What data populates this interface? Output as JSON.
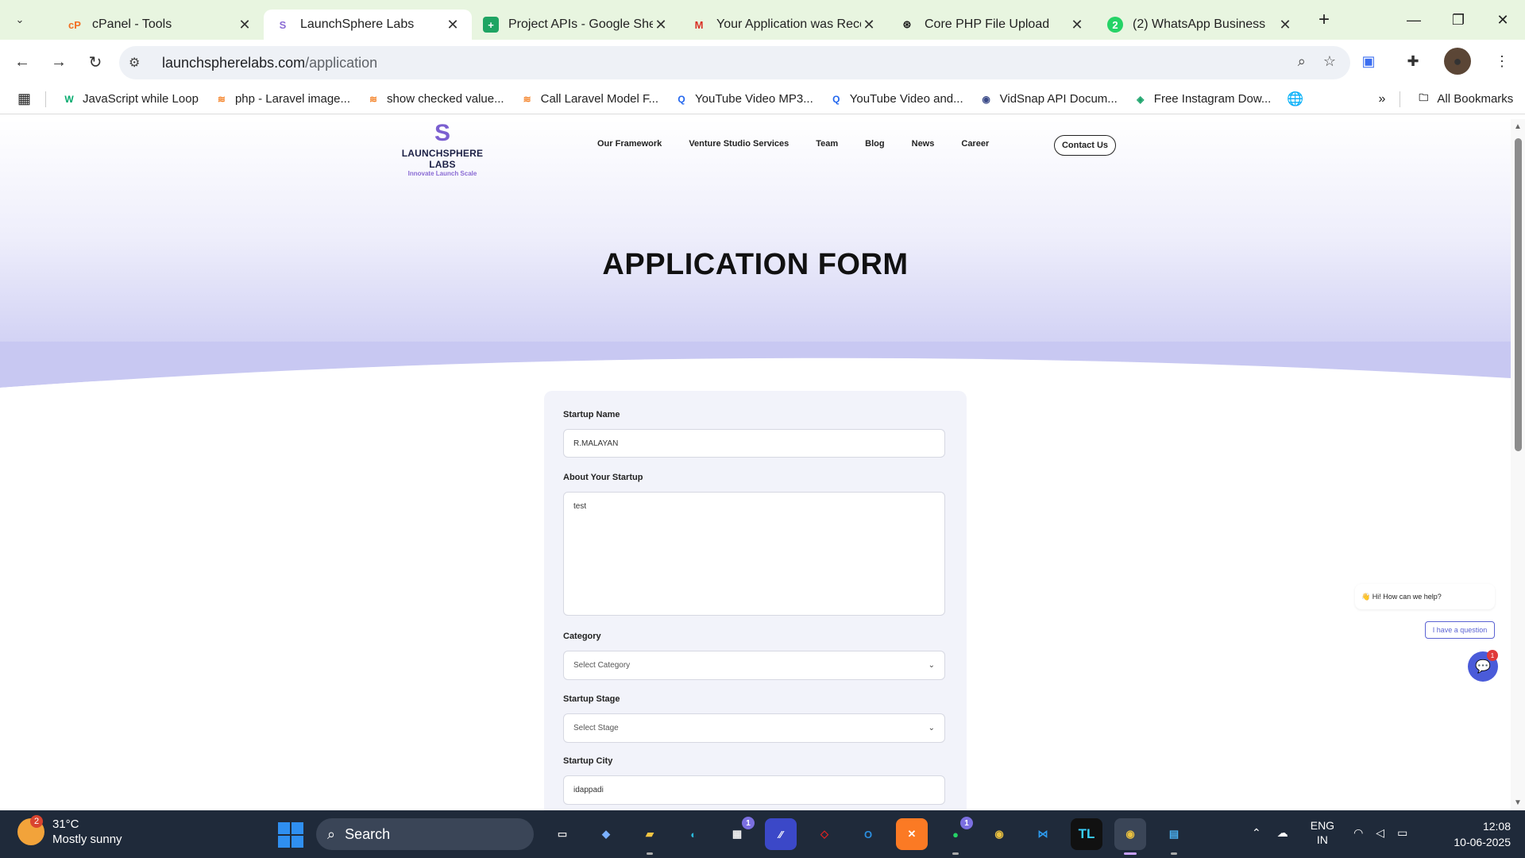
{
  "tabs": [
    {
      "title": "cPanel - Tools",
      "icon": "cpanel-icon",
      "active": false
    },
    {
      "title": "LaunchSphere Labs",
      "icon": "launchsphere-icon",
      "active": true
    },
    {
      "title": "Project APIs - Google Sheets",
      "icon": "google-sheets-icon",
      "active": false
    },
    {
      "title": "Your Application was Received",
      "icon": "gmail-icon",
      "active": false
    },
    {
      "title": "Core PHP File Upload",
      "icon": "chatgpt-icon",
      "active": false
    },
    {
      "title": "(2) WhatsApp Business",
      "icon": "whatsapp-icon",
      "active": false
    }
  ],
  "address": {
    "domain": "launchspherelabs.com",
    "path": "/application"
  },
  "bookmarks": [
    {
      "label": "JavaScript while Loop",
      "icon": "w3schools-icon"
    },
    {
      "label": "php - Laravel image...",
      "icon": "stackoverflow-icon"
    },
    {
      "label": "show checked value...",
      "icon": "stackoverflow-icon"
    },
    {
      "label": "Call Laravel Model F...",
      "icon": "stackoverflow-icon"
    },
    {
      "label": "YouTube Video MP3...",
      "icon": "q-icon"
    },
    {
      "label": "YouTube Video and...",
      "icon": "q-icon"
    },
    {
      "label": "VidSnap API Docum...",
      "icon": "vidsnap-icon"
    },
    {
      "label": "Free Instagram Dow...",
      "icon": "instagram-download-icon"
    }
  ],
  "bookmarks_all": "All Bookmarks",
  "site": {
    "logo_name": "LAUNCHSPHERE LABS",
    "logo_tag": "Innovate Launch Scale",
    "nav": [
      "Our Framework",
      "Venture Studio Services",
      "Team",
      "Blog",
      "News",
      "Career"
    ],
    "contact": "Contact Us",
    "page_title": "APPLICATION FORM"
  },
  "form": {
    "startup_name_label": "Startup Name",
    "startup_name_value": "R.MALAYAN",
    "about_label": "About Your Startup",
    "about_value": "test",
    "category_label": "Category",
    "category_value": "Select Category",
    "stage_label": "Startup Stage",
    "stage_value": "Select Stage",
    "city_label": "Startup City",
    "city_value": "idappadi"
  },
  "chat": {
    "greeting": "👋 Hi! How can we help?",
    "question_button": "I have a question",
    "badge": "1"
  },
  "taskbar": {
    "weather_temp": "31°C",
    "weather_desc": "Mostly sunny",
    "weather_badge": "2",
    "search": "Search",
    "store_badge": "1",
    "whatsapp_badge": "1",
    "lang_top": "ENG",
    "lang_bottom": "IN",
    "time": "12:08",
    "date": "10-06-2025"
  },
  "colors": {
    "accent": "#5b63d3",
    "hero_bottom": "#c8c8f2",
    "tab_strip": "#e8f5e0"
  }
}
